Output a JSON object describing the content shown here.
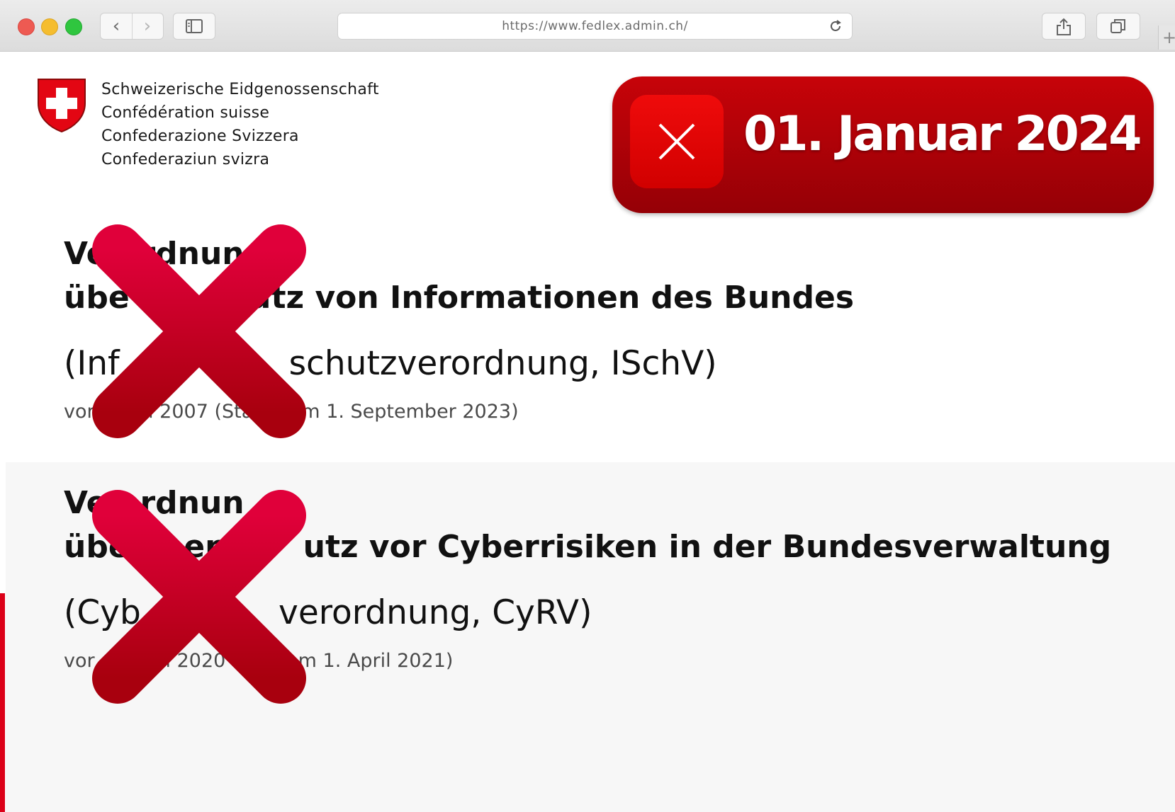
{
  "browser": {
    "url": "https://www.fedlex.admin.ch/",
    "new_tab_symbol": "+",
    "back_symbol": "‹",
    "forward_symbol": "›"
  },
  "header": {
    "org_names": [
      "Schweizerische Eidgenossenschaft",
      "Confédération suisse",
      "Confederazione Svizzera",
      "Confederaziun svizra"
    ]
  },
  "banner": {
    "date": "01. Januar 2024",
    "color": "#b80206"
  },
  "documents": [
    {
      "title_line1": "Ve   rdnun",
      "title_line2": "übe           utz von Informationen des Bundes",
      "short_title": "(Inf                schutzverordnung, ISchV)",
      "meta": "vor     Juli 2007 (Sta      am 1. September 2023)"
    },
    {
      "title_line1": "Ve   rdnun",
      "title_line2": "übe     en       utz vor Cyberrisiken in der Bundesverwaltung",
      "short_title": "(Cyb             verordnung, CyRV)",
      "meta": "vor       Mai 2020       d am 1. April 2021)"
    }
  ],
  "colors": {
    "cross": "#c8002a",
    "accent": "#dc0018",
    "swiss_red": "#e30613"
  }
}
